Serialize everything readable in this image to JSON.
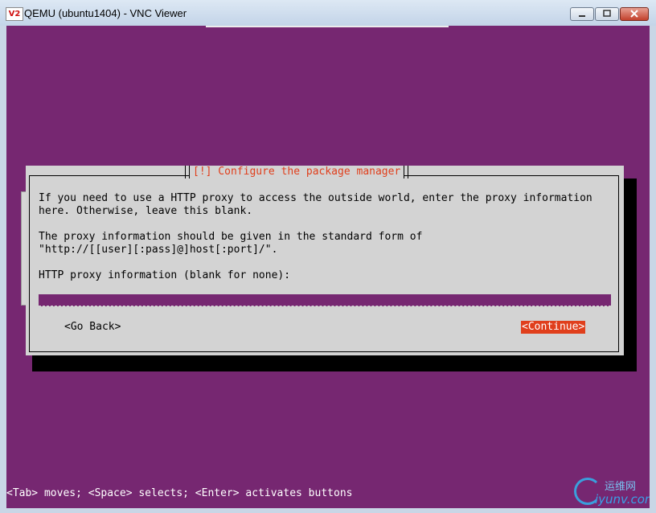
{
  "window": {
    "icon_text": "V2",
    "title": "QEMU (ubuntu1404) - VNC Viewer",
    "controls": [
      "minimize",
      "maximize",
      "close"
    ]
  },
  "installer": {
    "dialog_title": "[!] Configure the package manager",
    "paragraph1_line1": "If you need to use a HTTP proxy to access the outside world, enter the proxy information",
    "paragraph1_line2": "here. Otherwise, leave this blank.",
    "paragraph2_line1": "The proxy information should be given in the standard form of",
    "paragraph2_line2": "\"http://[[user][:pass]@]host[:port]/\".",
    "prompt": "HTTP proxy information (blank for none):",
    "proxy_value": "",
    "go_back_label": "<Go Back>",
    "continue_label": "<Continue>",
    "status_bar": "<Tab> moves; <Space> selects; <Enter> activates buttons"
  },
  "watermark": {
    "cn_text": "运维网",
    "domain": "iyunv.com"
  },
  "colors": {
    "desktop_purple": "#762771",
    "dialog_grey": "#d3d3d3",
    "accent_red": "#e03f1c"
  }
}
